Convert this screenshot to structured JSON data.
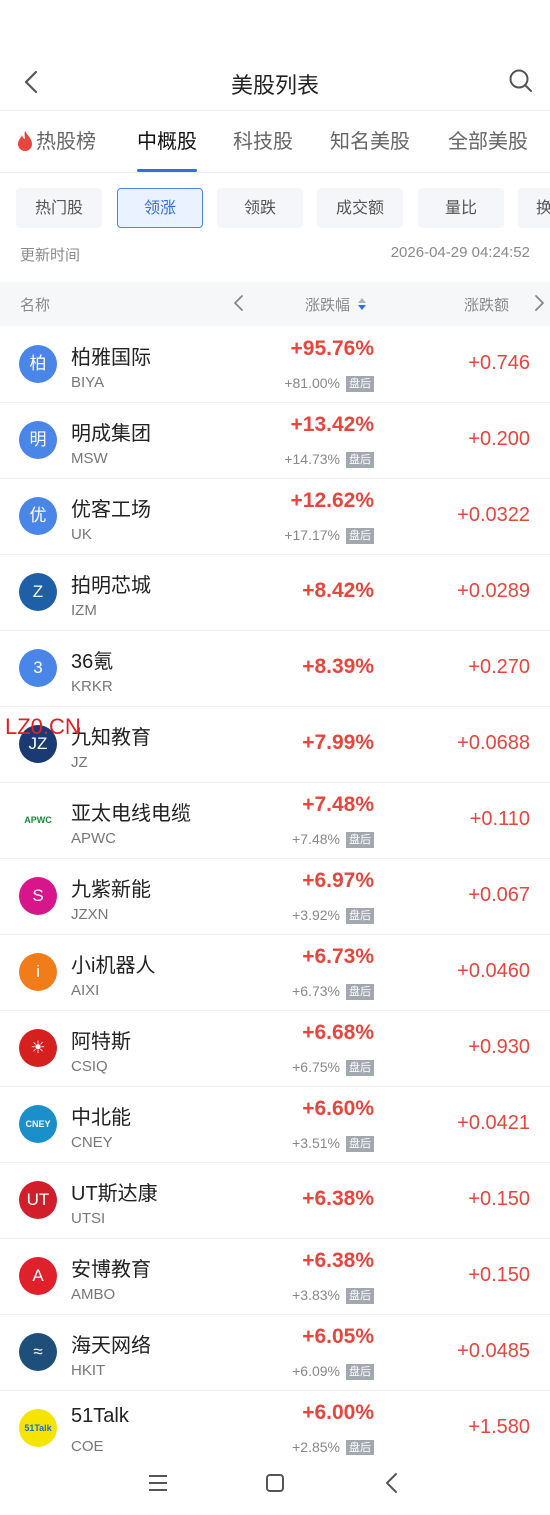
{
  "header": {
    "title": "美股列表"
  },
  "tabs": [
    {
      "label": "热股榜"
    },
    {
      "label": "中概股"
    },
    {
      "label": "科技股"
    },
    {
      "label": "知名美股"
    },
    {
      "label": "全部美股"
    }
  ],
  "filters": [
    "热门股",
    "领涨",
    "领跌",
    "成交额",
    "量比",
    "换"
  ],
  "update": {
    "label": "更新时间",
    "time": "2026-04-29 04:24:52"
  },
  "columns": {
    "name": "名称",
    "pct": "涨跌幅",
    "amt": "涨跌额"
  },
  "watermark": "LZ0.CN",
  "stocks": [
    {
      "name": "柏雅国际",
      "symbol": "BIYA",
      "pct": "+95.76%",
      "after": "+81.00%",
      "after_tag": "盘后",
      "amt": "+0.746",
      "logo_text": "柏",
      "logo_color": "#4a86e8"
    },
    {
      "name": "明成集团",
      "symbol": "MSW",
      "pct": "+13.42%",
      "after": "+14.73%",
      "after_tag": "盘后",
      "amt": "+0.200",
      "logo_text": "明",
      "logo_color": "#4a86e8"
    },
    {
      "name": "优客工场",
      "symbol": "UK",
      "pct": "+12.62%",
      "after": "+17.17%",
      "after_tag": "盘后",
      "amt": "+0.0322",
      "logo_text": "优",
      "logo_color": "#4a86e8"
    },
    {
      "name": "拍明芯城",
      "symbol": "IZM",
      "pct": "+8.42%",
      "amt": "+0.0289",
      "logo_text": "Z",
      "logo_color": "#1f5fa8"
    },
    {
      "name": "36氪",
      "symbol": "KRKR",
      "pct": "+8.39%",
      "amt": "+0.270",
      "logo_text": "3",
      "logo_color": "#4a86e8"
    },
    {
      "name": "九知教育",
      "symbol": "JZ",
      "pct": "+7.99%",
      "amt": "+0.0688",
      "logo_text": "JZ",
      "logo_color": "#1b3a73"
    },
    {
      "name": "亚太电线电缆",
      "symbol": "APWC",
      "pct": "+7.48%",
      "after": "+7.48%",
      "after_tag": "盘后",
      "amt": "+0.110",
      "logo_text": "APWC",
      "logo_color": "#ffffff"
    },
    {
      "name": "九紫新能",
      "symbol": "JZXN",
      "pct": "+6.97%",
      "after": "+3.92%",
      "after_tag": "盘后",
      "amt": "+0.067",
      "logo_text": "S",
      "logo_color": "#d6168a"
    },
    {
      "name": "小i机器人",
      "symbol": "AIXI",
      "pct": "+6.73%",
      "after": "+6.73%",
      "after_tag": "盘后",
      "amt": "+0.0460",
      "logo_text": "i",
      "logo_color": "#f07d1a"
    },
    {
      "name": "阿特斯",
      "symbol": "CSIQ",
      "pct": "+6.68%",
      "after": "+6.75%",
      "after_tag": "盘后",
      "amt": "+0.930",
      "logo_text": "☀",
      "logo_color": "#d62020"
    },
    {
      "name": "中北能",
      "symbol": "CNEY",
      "pct": "+6.60%",
      "after": "+3.51%",
      "after_tag": "盘后",
      "amt": "+0.0421",
      "logo_text": "CNEY",
      "logo_color": "#1a8fc9"
    },
    {
      "name": "UT斯达康",
      "symbol": "UTSI",
      "pct": "+6.38%",
      "amt": "+0.150",
      "logo_text": "UT",
      "logo_color": "#d01f2a"
    },
    {
      "name": "安博教育",
      "symbol": "AMBO",
      "pct": "+6.38%",
      "after": "+3.83%",
      "after_tag": "盘后",
      "amt": "+0.150",
      "logo_text": "A",
      "logo_color": "#e0202a"
    },
    {
      "name": "海天网络",
      "symbol": "HKIT",
      "pct": "+6.05%",
      "after": "+6.09%",
      "after_tag": "盘后",
      "amt": "+0.0485",
      "logo_text": "≈",
      "logo_color": "#1d4f7a"
    },
    {
      "name": "51Talk",
      "symbol": "COE",
      "pct": "+6.00%",
      "after": "+2.85%",
      "after_tag": "盘后",
      "amt": "+1.580",
      "logo_text": "51Talk",
      "logo_color": "#f5e400"
    }
  ]
}
